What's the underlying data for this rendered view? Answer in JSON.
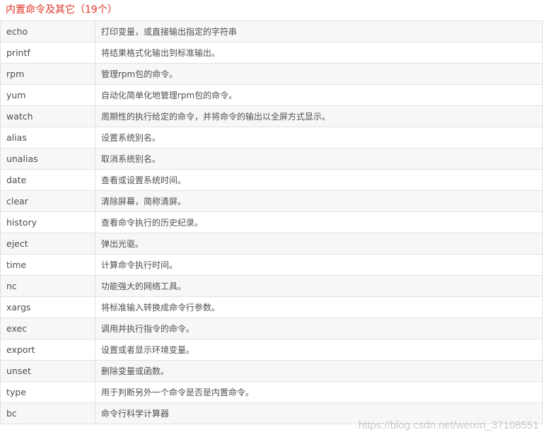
{
  "heading": "内置命令及其它（19个）",
  "rows": [
    {
      "command": "echo",
      "description": "打印变量，或直接输出指定的字符串"
    },
    {
      "command": "printf",
      "description": "将结果格式化输出到标准输出。"
    },
    {
      "command": "rpm",
      "description": "管理rpm包的命令。"
    },
    {
      "command": "yum",
      "description": "自动化简单化地管理rpm包的命令。"
    },
    {
      "command": "watch",
      "description": "周期性的执行给定的命令，并将命令的输出以全屏方式显示。"
    },
    {
      "command": "alias",
      "description": "设置系统别名。"
    },
    {
      "command": "unalias",
      "description": "取消系统别名。"
    },
    {
      "command": "date",
      "description": "查看或设置系统时间。"
    },
    {
      "command": "clear",
      "description": "清除屏幕，简称清屏。"
    },
    {
      "command": "history",
      "description": "查看命令执行的历史纪录。"
    },
    {
      "command": "eject",
      "description": "弹出光驱。"
    },
    {
      "command": "time",
      "description": "计算命令执行时间。"
    },
    {
      "command": "nc",
      "description": "功能强大的网络工具。"
    },
    {
      "command": "xargs",
      "description": "将标准输入转换成命令行参数。"
    },
    {
      "command": "exec",
      "description": "调用并执行指令的命令。"
    },
    {
      "command": "export",
      "description": "设置或者显示环境变量。"
    },
    {
      "command": "unset",
      "description": "删除变量或函数。"
    },
    {
      "command": "type",
      "description": "用于判断另外一个命令是否是内置命令。"
    },
    {
      "command": "bc",
      "description": "命令行科学计算器"
    }
  ],
  "watermark": "https://blog.csdn.net/weixin_37108551"
}
